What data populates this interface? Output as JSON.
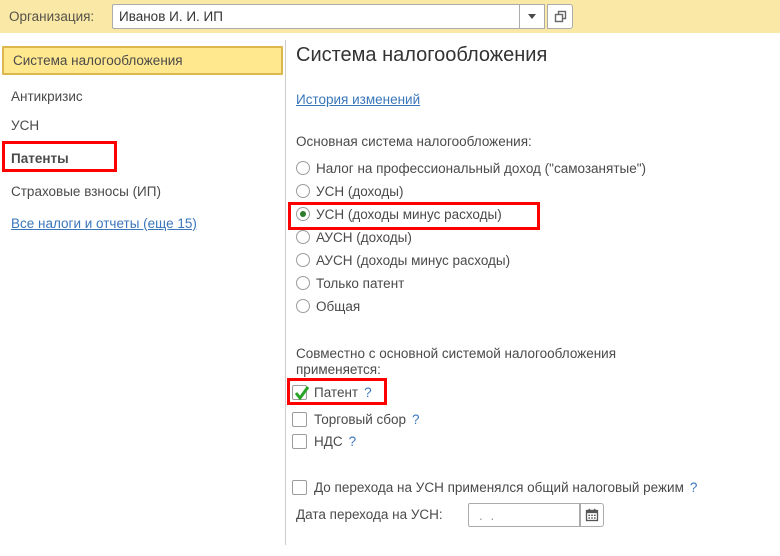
{
  "topbar": {
    "org_label": "Организация:",
    "org_value": "Иванов И. И. ИП"
  },
  "sidebar": {
    "items": [
      {
        "label": "Система налогообложения",
        "selected": true
      },
      {
        "label": "Антикризис",
        "selected": false
      },
      {
        "label": "УСН",
        "selected": false
      },
      {
        "label": "Патенты",
        "selected": false,
        "highlighted": true
      },
      {
        "label": "Страховые взносы (ИП)",
        "selected": false
      },
      {
        "label": "Все налоги и отчеты (еще 15)",
        "selected": false,
        "link": true
      }
    ]
  },
  "main": {
    "title": "Система налогообложения",
    "history_link": "История изменений",
    "primary": {
      "label": "Основная система налогообложения:",
      "options": [
        {
          "label": "Налог на профессиональный доход (\"самозанятые\")",
          "selected": false
        },
        {
          "label": "УСН (доходы)",
          "selected": false
        },
        {
          "label": "УСН (доходы минус расходы)",
          "selected": true,
          "highlighted": true
        },
        {
          "label": "АУСН (доходы)",
          "selected": false
        },
        {
          "label": "АУСН (доходы минус расходы)",
          "selected": false
        },
        {
          "label": "Только патент",
          "selected": false
        },
        {
          "label": "Общая",
          "selected": false
        }
      ]
    },
    "secondary": {
      "label": "Совместно с основной системой налогообложения применяется:",
      "options": [
        {
          "label": "Патент",
          "checked": true,
          "help": "?",
          "highlighted": true
        },
        {
          "label": "Торговый сбор",
          "checked": false,
          "help": "?"
        },
        {
          "label": "НДС",
          "checked": false,
          "help": "?"
        }
      ]
    },
    "transition": {
      "checkbox_label": "До перехода на УСН применялся общий налоговый режим",
      "checkbox_checked": false,
      "help": "?",
      "date_label": "Дата перехода на УСН:",
      "date_value": ".  ."
    }
  },
  "colors": {
    "topbar_bg": "#FAE8A6",
    "selected_item_bg": "#FFE88D",
    "selected_item_border": "#DBB74D",
    "highlight_box": "#FF0000",
    "link": "#3A76BA",
    "check_green": "#27A427",
    "radio_dot_green": "#2B7D2B"
  }
}
